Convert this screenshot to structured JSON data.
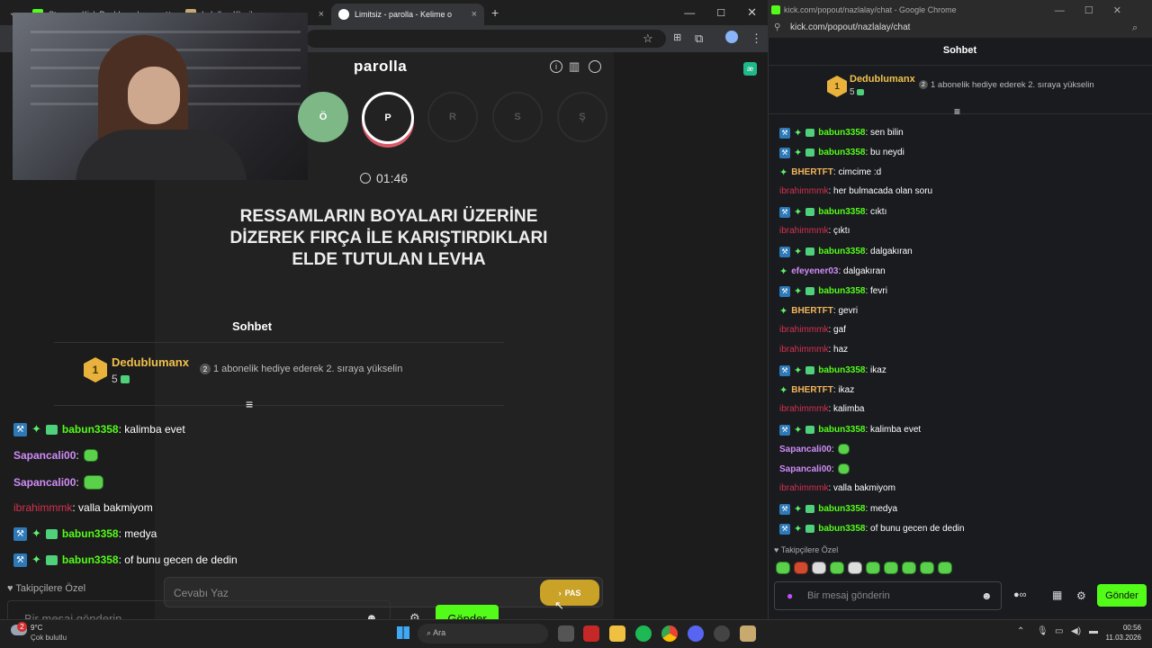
{
  "tabs": [
    {
      "label": "Stream - Kick Dashboard",
      "color": "#53fc18"
    },
    {
      "label": "LoLdle - Klasik",
      "color": "#c8aa6e"
    },
    {
      "label": "Limitsiz - parolla - Kelime o",
      "color": "#ffffff"
    }
  ],
  "left_browser": {
    "tab_close": "×",
    "new_tab": "+"
  },
  "game": {
    "title": "parolla",
    "letters": [
      "Ö",
      "P",
      "R",
      "S",
      "Ş"
    ],
    "timer": "01:46",
    "question_lines": [
      "RESSAMLARIN BOYALARI ÜZERİNE",
      "DİZEREK FIRÇA İLE KARIŞTIRDIKLARI",
      "ELDE TUTULAN LEVHA"
    ],
    "answer_placeholder": "Cevabı Yaz",
    "pas_label": "PAS"
  },
  "left_chat": {
    "title": "Sohbet",
    "top_user": "Dedublumanx",
    "rank": "1",
    "gift_count": "5",
    "gift_text": "1 abonelik hediye ederek 2. sıraya yükselin",
    "gift_num": "2",
    "messages": [
      {
        "user": "babun3358",
        "text": "kalimba evet",
        "style": "grn",
        "badges": true,
        "emote": false
      },
      {
        "user": "Sapancali00",
        "text": "",
        "style": "purp",
        "badges": false,
        "emote": true
      },
      {
        "user": "Sapancali00",
        "text": "",
        "style": "purp",
        "badges": false,
        "emote": true
      },
      {
        "user": "ibrahimmmk",
        "text": "valla bakmiyom",
        "style": "red",
        "badges": false,
        "emote": false
      },
      {
        "user": "babun3358",
        "text": "medya",
        "style": "grn",
        "badges": true,
        "emote": false
      },
      {
        "user": "babun3358",
        "text": "of bunu gecen de dedin",
        "style": "grn",
        "badges": true,
        "emote": false
      }
    ],
    "followers_only": "Takipçilere Özel",
    "input_placeholder": "Bir mesaj gönderin",
    "send": "Gönder"
  },
  "right_window": {
    "title": "kick.com/popout/nazlalay/chat - Google Chrome",
    "url": "kick.com/popout/nazlalay/chat",
    "chat_title": "Sohbet",
    "top_user": "Dedublumanx",
    "rank": "1",
    "gift_count": "5",
    "gift_text": "1 abonelik hediye ederek 2. sıraya yükselin",
    "gift_num": "2",
    "messages": [
      {
        "user": "babun3358",
        "text": "sen bilin",
        "style": "grn",
        "mod": true
      },
      {
        "user": "babun3358",
        "text": "bu neydi",
        "style": "grn",
        "mod": true
      },
      {
        "user": "BHERTFT",
        "text": "cimcime :d",
        "style": "orng",
        "mod": false,
        "star": true
      },
      {
        "user": "ibrahimmmk",
        "text": "her bulmacada olan soru",
        "style": "red"
      },
      {
        "user": "babun3358",
        "text": "cıktı",
        "style": "grn",
        "mod": true
      },
      {
        "user": "ibrahimmmk",
        "text": "çıktı",
        "style": "red"
      },
      {
        "user": "babun3358",
        "text": "dalgakıran",
        "style": "grn",
        "mod": true
      },
      {
        "user": "efeyener03",
        "text": "dalgakıran",
        "style": "purp",
        "star": true
      },
      {
        "user": "babun3358",
        "text": "fevri",
        "style": "grn",
        "mod": true
      },
      {
        "user": "BHERTFT",
        "text": "gevri",
        "style": "orng",
        "star": true
      },
      {
        "user": "ibrahimmmk",
        "text": "gaf",
        "style": "red"
      },
      {
        "user": "ibrahimmmk",
        "text": "haz",
        "style": "red"
      },
      {
        "user": "babun3358",
        "text": "ikaz",
        "style": "grn",
        "mod": true
      },
      {
        "user": "BHERTFT",
        "text": "ikaz",
        "style": "orng",
        "star": true
      },
      {
        "user": "ibrahimmmk",
        "text": "kalimba",
        "style": "red"
      },
      {
        "user": "babun3358",
        "text": "kalimba evet",
        "style": "grn",
        "mod": true
      },
      {
        "user": "Sapancali00",
        "text": "",
        "style": "purp",
        "emote": true
      },
      {
        "user": "Sapancali00",
        "text": "",
        "style": "purp",
        "emote": true
      },
      {
        "user": "ibrahimmmk",
        "text": "valla bakmiyom",
        "style": "red"
      },
      {
        "user": "babun3358",
        "text": "medya",
        "style": "grn",
        "mod": true
      },
      {
        "user": "babun3358",
        "text": "of bunu gecen de dedin",
        "style": "grn",
        "mod": true
      }
    ],
    "followers_only": "Takipçilere Özel",
    "input_placeholder": "Bir mesaj gönderin",
    "send": "Gönder"
  },
  "taskbar": {
    "weather_temp": "9°C",
    "weather_text": "Çok bulutlu",
    "search": "Ara",
    "time": "00:56",
    "date": "11.03.2026",
    "notif_count": "2"
  }
}
